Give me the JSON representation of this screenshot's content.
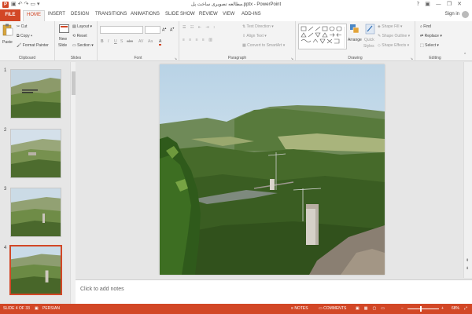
{
  "window": {
    "title": "مطالعه تصویری ساخت پل.pptx - PowerPoint",
    "question_mark": "?",
    "sign_in": "Sign in"
  },
  "tabs": [
    {
      "label": "FILE"
    },
    {
      "label": "HOME"
    },
    {
      "label": "INSERT"
    },
    {
      "label": "DESIGN"
    },
    {
      "label": "TRANSITIONS"
    },
    {
      "label": "ANIMATIONS"
    },
    {
      "label": "SLIDE SHOW"
    },
    {
      "label": "REVIEW"
    },
    {
      "label": "VIEW"
    },
    {
      "label": "ADD-INS"
    }
  ],
  "ribbon": {
    "clipboard": {
      "label": "Clipboard",
      "paste": "Paste",
      "cut": "Cut",
      "copy": "Copy",
      "format_painter": "Format Painter"
    },
    "slides": {
      "label": "Slides",
      "new_slide_1": "New",
      "new_slide_2": "Slide",
      "layout": "Layout",
      "reset": "Reset",
      "section": "Section"
    },
    "font": {
      "label": "Font",
      "bold": "B",
      "italic": "I",
      "underline": "U",
      "shadow": "S",
      "strike": "abc"
    },
    "paragraph": {
      "label": "Paragraph",
      "text_direction": "Text Direction",
      "align_text": "Align Text",
      "convert_smartart": "Convert to SmartArt"
    },
    "drawing": {
      "label": "Drawing",
      "arrange": "Arrange",
      "quick_styles_1": "Quick",
      "quick_styles_2": "Styles",
      "shape_fill": "Shape Fill",
      "shape_outline": "Shape Outline",
      "shape_effects": "Shape Effects"
    },
    "editing": {
      "label": "Editing",
      "find": "Find",
      "replace": "Replace",
      "select": "Select"
    }
  },
  "slides": [
    {
      "number": "1"
    },
    {
      "number": "2"
    },
    {
      "number": "3"
    },
    {
      "number": "4"
    }
  ],
  "notes": {
    "placeholder": "Click to add notes"
  },
  "status": {
    "slide_counter": "SLIDE 4 OF 33",
    "language": "PERSIAN",
    "notes": "NOTES",
    "comments": "COMMENTS",
    "zoom": "68%"
  },
  "colors": {
    "accent": "#d24726"
  }
}
